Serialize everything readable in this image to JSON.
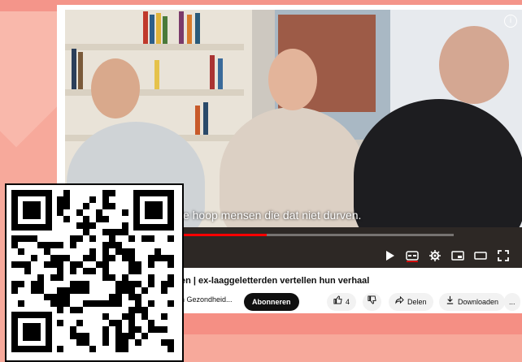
{
  "video": {
    "caption": "t er zijn een hele hoop mensen die dat niet durven.",
    "progress_fraction": 0.45
  },
  "controls": {
    "icons": [
      "play-icon",
      "subtitles-icon",
      "settings-icon",
      "miniplayer-icon",
      "theater-icon",
      "fullscreen-icon"
    ]
  },
  "meta": {
    "title": "en | ex-laaggeletterden vertellen hun verhaal",
    "channel": "n Gezondheid...",
    "subscribe_label": "Abonneren",
    "like_count": "4",
    "share_label": "Delen",
    "download_label": "Downloaden",
    "more_label": "..."
  },
  "colors": {
    "background": "#f7a99b",
    "accent_red": "#ff0000",
    "subscribe_bg": "#0f0f0f"
  }
}
